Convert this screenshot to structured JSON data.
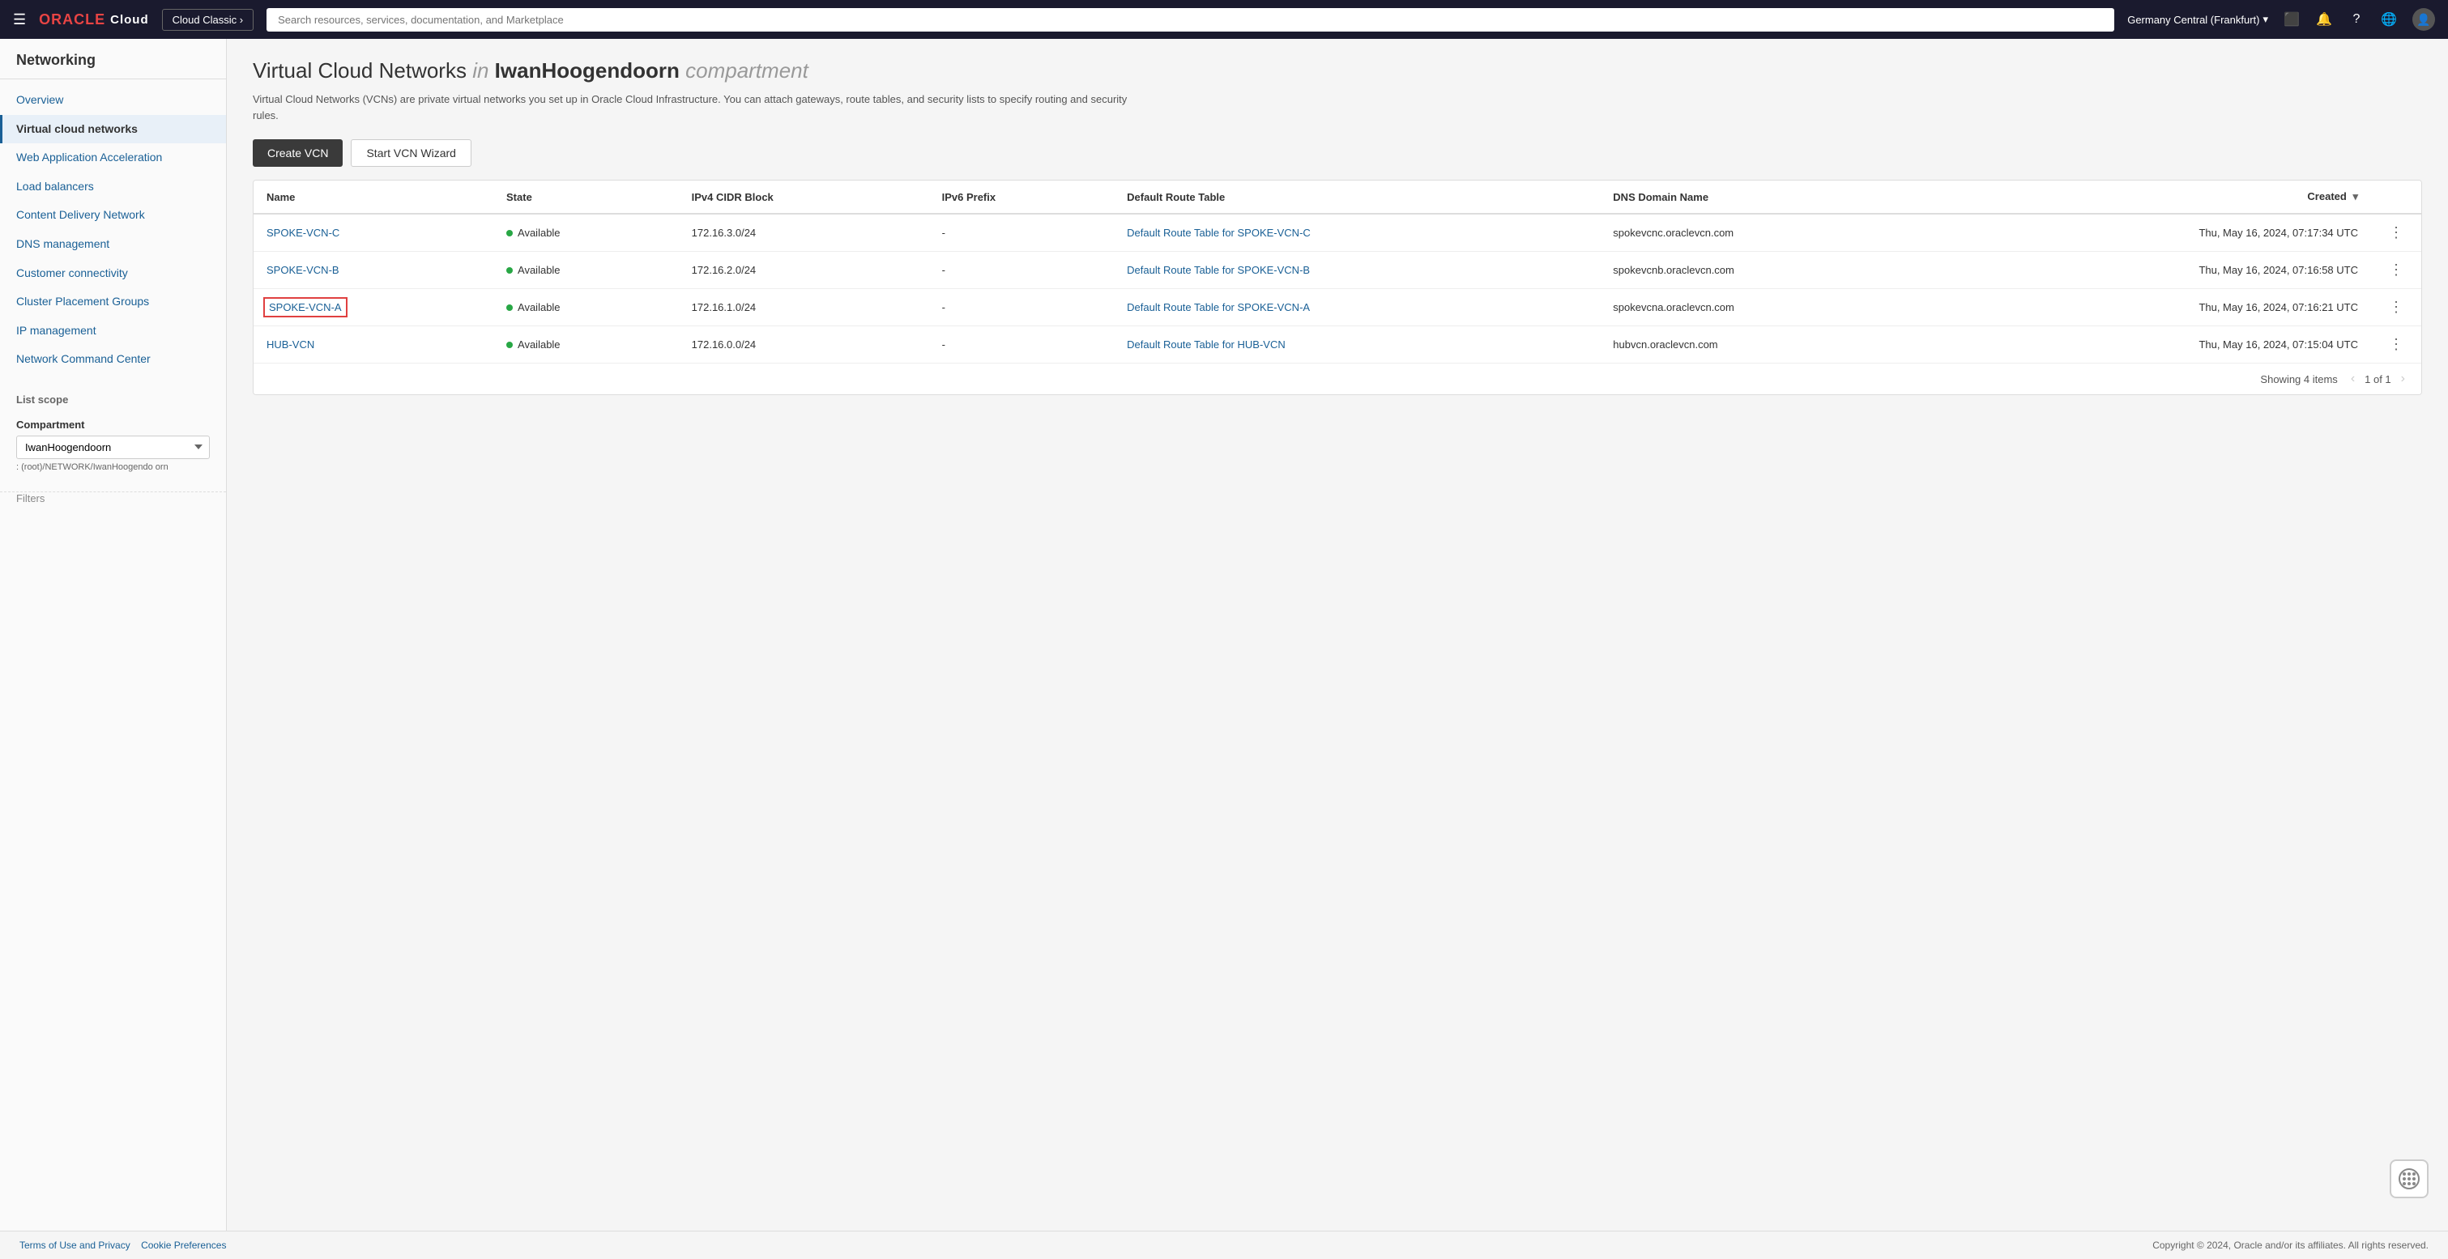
{
  "topnav": {
    "hamburger": "☰",
    "oracle_label": "ORACLE",
    "cloud_label": "Cloud",
    "cloud_classic_btn": "Cloud Classic ›",
    "search_placeholder": "Search resources, services, documentation, and Marketplace",
    "region": "Germany Central (Frankfurt)",
    "region_chevron": "▾",
    "dev_icon": "⬜",
    "bell_icon": "🔔",
    "help_icon": "?",
    "globe_icon": "🌐",
    "avatar_icon": "👤"
  },
  "sidebar": {
    "title": "Networking",
    "items": [
      {
        "label": "Overview",
        "active": false
      },
      {
        "label": "Virtual cloud networks",
        "active": true
      },
      {
        "label": "Web Application Acceleration",
        "active": false
      },
      {
        "label": "Load balancers",
        "active": false
      },
      {
        "label": "Content Delivery Network",
        "active": false
      },
      {
        "label": "DNS management",
        "active": false
      },
      {
        "label": "Customer connectivity",
        "active": false
      },
      {
        "label": "Cluster Placement Groups",
        "active": false
      },
      {
        "label": "IP management",
        "active": false
      },
      {
        "label": "Network Command Center",
        "active": false
      }
    ]
  },
  "scope": {
    "section_label": "List scope",
    "compartment_label": "Compartment",
    "compartment_value": "IwanHoogendoorn",
    "compartment_path": ": (root)/NETWORK/IwanHoogendo\norn"
  },
  "page": {
    "title_prefix": "Virtual Cloud Networks",
    "title_italic": "in",
    "title_name": "IwanHoogendoorn",
    "title_suffix_italic": "compartment",
    "description": "Virtual Cloud Networks (VCNs) are private virtual networks you set up in Oracle Cloud Infrastructure. You can attach gateways, route tables, and security lists to specify routing and security rules."
  },
  "toolbar": {
    "create_vcn": "Create VCN",
    "start_wizard": "Start VCN Wizard"
  },
  "table": {
    "columns": [
      {
        "key": "name",
        "label": "Name"
      },
      {
        "key": "state",
        "label": "State"
      },
      {
        "key": "ipv4",
        "label": "IPv4 CIDR Block"
      },
      {
        "key": "ipv6",
        "label": "IPv6 Prefix"
      },
      {
        "key": "route_table",
        "label": "Default Route Table"
      },
      {
        "key": "dns",
        "label": "DNS Domain Name"
      },
      {
        "key": "created",
        "label": "Created",
        "sort": "▾"
      }
    ],
    "rows": [
      {
        "name": "SPOKE-VCN-C",
        "name_link": true,
        "state": "Available",
        "ipv4": "172.16.3.0/24",
        "ipv6": "-",
        "route_table": "Default Route Table for SPOKE-VCN-C",
        "route_table_link": true,
        "dns": "spokevcnc.oraclevcn.com",
        "created": "Thu, May 16, 2024, 07:17:34 UTC",
        "highlighted": false
      },
      {
        "name": "SPOKE-VCN-B",
        "name_link": true,
        "state": "Available",
        "ipv4": "172.16.2.0/24",
        "ipv6": "-",
        "route_table": "Default Route Table for SPOKE-VCN-B",
        "route_table_link": true,
        "dns": "spokevcnb.oraclevcn.com",
        "created": "Thu, May 16, 2024, 07:16:58 UTC",
        "highlighted": false
      },
      {
        "name": "SPOKE-VCN-A",
        "name_link": true,
        "state": "Available",
        "ipv4": "172.16.1.0/24",
        "ipv6": "-",
        "route_table": "Default Route Table for SPOKE-VCN-A",
        "route_table_link": true,
        "dns": "spokevcna.oraclevcn.com",
        "created": "Thu, May 16, 2024, 07:16:21 UTC",
        "highlighted": true
      },
      {
        "name": "HUB-VCN",
        "name_link": true,
        "state": "Available",
        "ipv4": "172.16.0.0/24",
        "ipv6": "-",
        "route_table": "Default Route Table for HUB-VCN",
        "route_table_link": true,
        "dns": "hubvcn.oraclevcn.com",
        "created": "Thu, May 16, 2024, 07:15:04 UTC",
        "highlighted": false
      }
    ],
    "showing_label": "Showing 4 items",
    "page_label": "1 of 1"
  },
  "footer": {
    "terms": "Terms of Use and Privacy",
    "cookies": "Cookie Preferences",
    "copyright": "Copyright © 2024, Oracle and/or its affiliates. All rights reserved."
  },
  "filters": {
    "label": "Filters"
  }
}
